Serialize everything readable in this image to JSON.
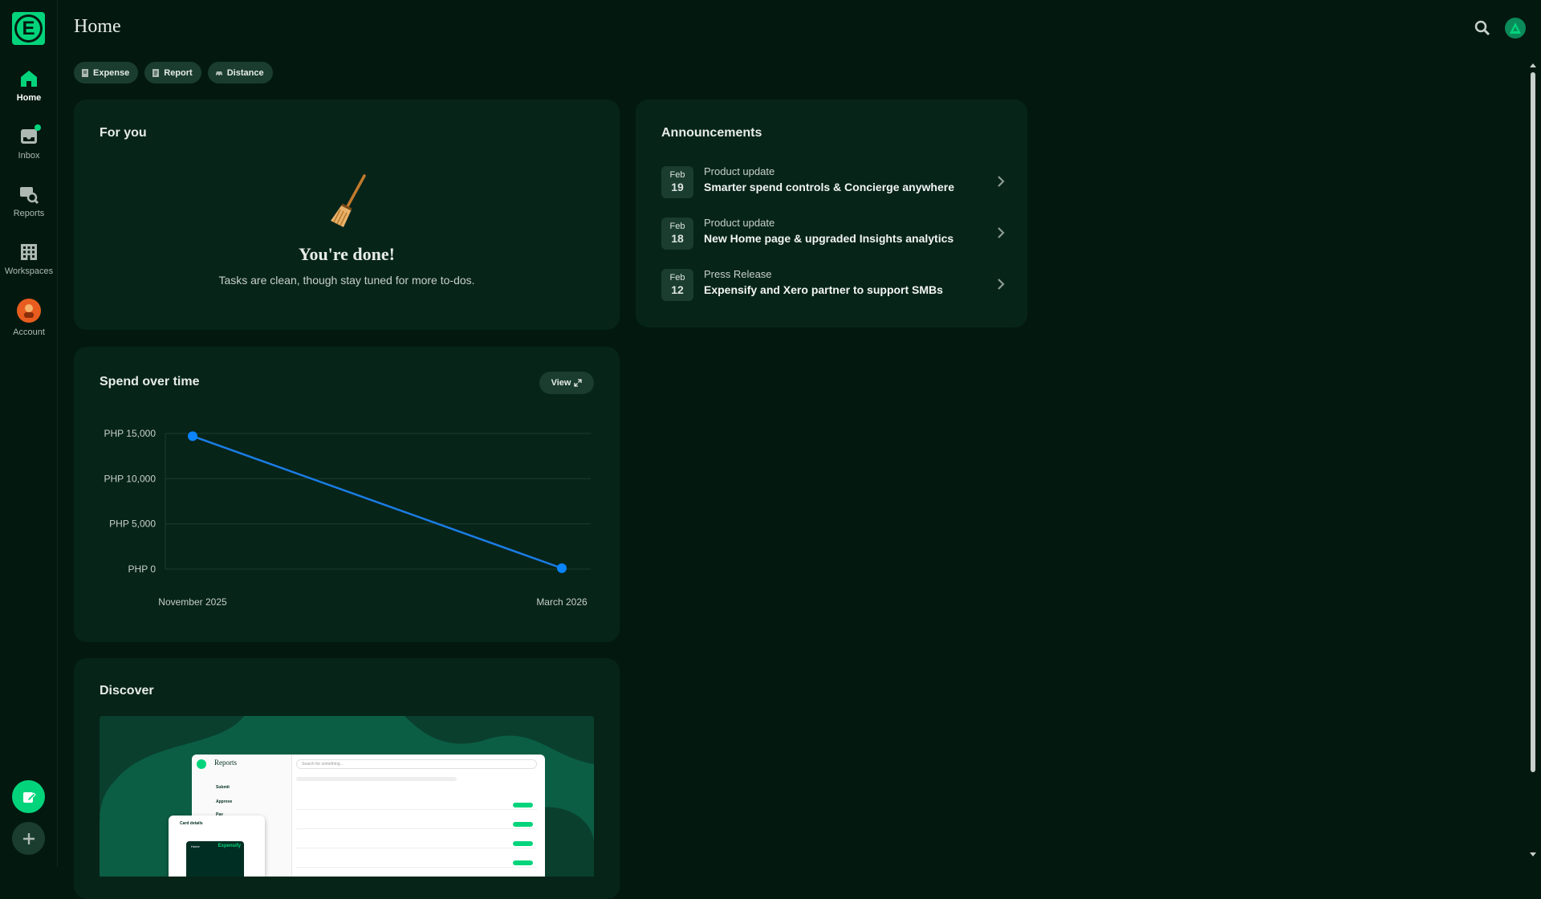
{
  "nav": {
    "home": "Home",
    "inbox": "Inbox",
    "reports": "Reports",
    "workspaces": "Workspaces",
    "account": "Account"
  },
  "header": {
    "title": "Home"
  },
  "quick_actions": {
    "expense": "Expense",
    "report": "Report",
    "distance": "Distance"
  },
  "for_you": {
    "title": "For you",
    "done_title": "You're done!",
    "done_sub": "Tasks are clean, though stay tuned for more to-dos."
  },
  "announcements": {
    "title": "Announcements",
    "items": [
      {
        "month": "Feb",
        "day": "19",
        "type": "Product update",
        "title": "Smarter spend controls & Concierge anywhere"
      },
      {
        "month": "Feb",
        "day": "18",
        "type": "Product update",
        "title": "New Home page & upgraded Insights analytics"
      },
      {
        "month": "Feb",
        "day": "12",
        "type": "Press Release",
        "title": "Expensify and Xero partner to support SMBs"
      }
    ]
  },
  "spend": {
    "title": "Spend over time",
    "view_label": "View"
  },
  "chart_data": {
    "type": "line",
    "x": [
      "November 2025",
      "March 2026"
    ],
    "series": [
      {
        "values": [
          14700,
          100
        ]
      }
    ],
    "yticks": [
      "PHP 15,000",
      "PHP 10,000",
      "PHP 5,000",
      "PHP 0"
    ],
    "ytick_values": [
      15000,
      10000,
      5000,
      0
    ],
    "ylim": [
      0,
      15000
    ],
    "grid": true,
    "line_color": "#1b7ce4",
    "point_color": "#0b84ff"
  },
  "discover": {
    "title": "Discover",
    "preview": {
      "reports_title": "Reports",
      "search_placeholder": "Search for something...",
      "side_items": [
        "Submit",
        "Approve",
        "Pay"
      ],
      "card_details": "Card details",
      "brand": "Expensify",
      "home": "Home"
    }
  },
  "colors": {
    "accent": "#03d47c",
    "background": "#03190f",
    "card": "#072419"
  }
}
